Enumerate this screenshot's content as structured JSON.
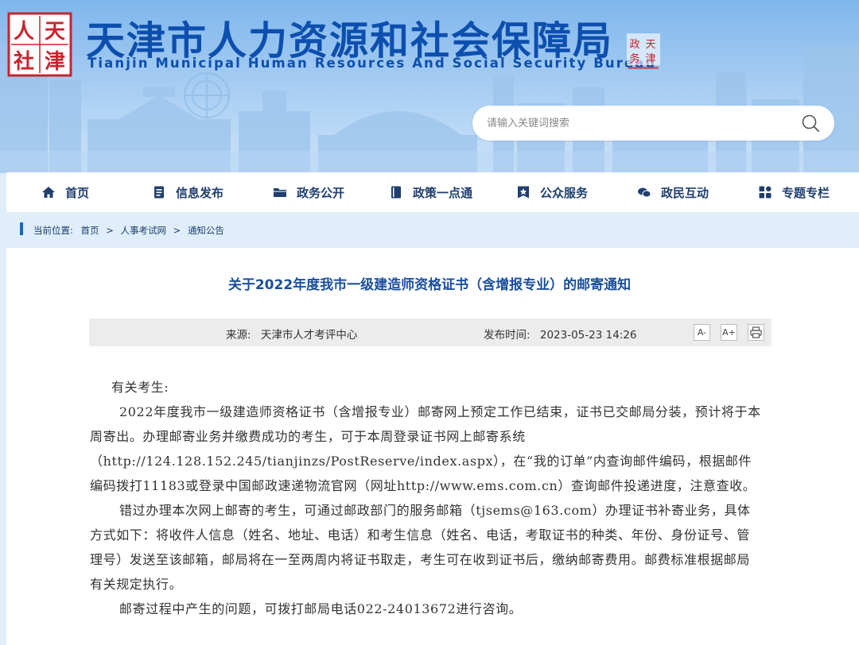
{
  "header": {
    "title": "天津市人力资源和社会保障局",
    "subtitle": "Tianjin Municipal Human Resources And Social Security Bureau",
    "logo_chars": [
      "人",
      "天",
      "社",
      "津"
    ]
  },
  "search": {
    "placeholder": "请输入关键词搜索"
  },
  "nav": {
    "items": [
      {
        "label": "首页",
        "icon": "home-icon"
      },
      {
        "label": "信息发布",
        "icon": "document-icon"
      },
      {
        "label": "政务公开",
        "icon": "folder-icon"
      },
      {
        "label": "政策一点通",
        "icon": "book-icon"
      },
      {
        "label": "公众服务",
        "icon": "star-badge-icon"
      },
      {
        "label": "政民互动",
        "icon": "chat-icon"
      },
      {
        "label": "专题专栏",
        "icon": "grid-icon"
      }
    ]
  },
  "breadcrumb": {
    "prefix": "当前位置:",
    "items": [
      "首页",
      "人事考试网",
      "通知公告"
    ],
    "separator": ">"
  },
  "article": {
    "title": "关于2022年度我市一级建造师资格证书（含增报专业）的邮寄通知",
    "source_label": "来源:",
    "source": "天津市人才考评中心",
    "time_label": "发布时间:",
    "time": "2023-05-23 14:26",
    "font_decrease": "A-",
    "font_increase": "A+",
    "print": "print-icon",
    "greeting": "有关考生:",
    "paragraphs": [
      "2022年度我市一级建造师资格证书（含增报专业）邮寄网上预定工作已结束，证书已交邮局分装，预计将于本周寄出。办理邮寄业务并缴费成功的考生，可于本周登录证书网上邮寄系统（http://124.128.152.245/tianjinzs/PostReserve/index.aspx），在“我的订单”内查询邮件编码，根据邮件编码拨打11183或登录中国邮政速递物流官网（网址http://www.ems.com.cn）查询邮件投递进度，注意查收。",
      "错过办理本次网上邮寄的考生，可通过邮政部门的服务邮箱（tjsems@163.com）办理证书补寄业务，具体方式如下：将收件人信息（姓名、地址、电话）和考生信息（姓名、电话，考取证书的种类、年份、身份证号、管理号）发送至该邮箱，邮局将在一至两周内将证书取走，考生可在收到证书后，缴纳邮寄费用。邮费标准根据邮局有关规定执行。",
      "邮寄过程中产生的问题，可拨打邮局电话022-24013672进行咨询。"
    ]
  },
  "colors": {
    "brand_blue": "#0d4fae",
    "logo_red": "#c8242b",
    "nav_text": "#1f3f6e",
    "title_blue": "#1a4f9c"
  }
}
